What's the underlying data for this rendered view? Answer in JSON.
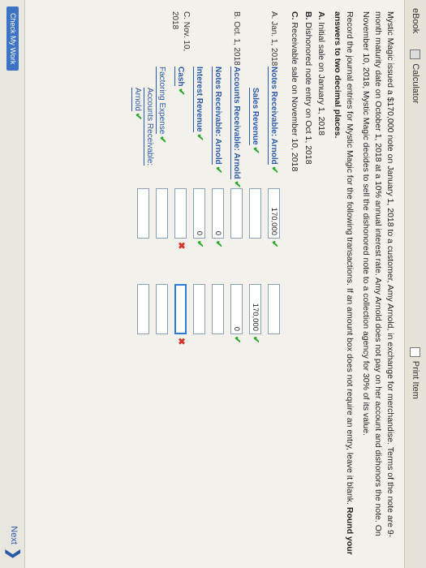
{
  "toolbar": {
    "ebook": "eBook",
    "calculator": "Calculator",
    "print": "Print Item"
  },
  "problem": {
    "paragraph": "Mystic Magic issued a $170,000 note on January 1, 2018 to a customer, Amy Arnold, in exchange for merchandise. Terms of the note are 9-month maturity date on October 1, 2018 at a 10% annual interest rate. Amy Arnold does not pay on her account and dishonors the note. On November 10, 2018, Mystic Magic decides to sell the dishonored note to a collection agency for 30% of its value.",
    "instruction": "Record the journal entries for Mystic Magic for the following transactions. If an amount box does not require an entry, leave it blank.",
    "instruction_bold": "Round your answers to two decimal places.",
    "transactions": [
      {
        "label": "A.",
        "text": "Initial sale on January 1, 2018"
      },
      {
        "label": "B.",
        "text": "Dishonored note entry on Oct 1, 2018"
      },
      {
        "label": "C.",
        "text": "Receivable sale on November 10, 2018"
      }
    ]
  },
  "journal": {
    "rows": [
      {
        "date": "A. Jan. 1, 2018",
        "account": "Notes Receivable: Arnold",
        "debit": "170,000",
        "credit": "",
        "debit_mark": "✔",
        "credit_mark": ""
      },
      {
        "date": "",
        "account": "Sales Revenue",
        "debit": "",
        "credit": "170,000",
        "debit_mark": "",
        "credit_mark": "✔"
      },
      {
        "date": "B. Oct. 1, 2018",
        "account": "Accounts Receivable: Arnold",
        "debit": "",
        "credit": "0",
        "debit_mark": "",
        "credit_mark": "✔"
      },
      {
        "date": "",
        "account": "Notes Receivable: Arnold",
        "debit": "0",
        "credit": "",
        "debit_mark": "✔",
        "credit_mark": ""
      },
      {
        "date": "",
        "account": "Interest Revenue",
        "debit": "0",
        "credit": "",
        "debit_mark": "✔",
        "credit_mark": ""
      },
      {
        "date": "C. Nov. 10, 2018",
        "account": "Cash",
        "debit": "",
        "credit": "",
        "debit_mark": "✖",
        "credit_mark": "✖"
      },
      {
        "date": "",
        "account": "Factoring Expense",
        "debit": "",
        "credit": "",
        "debit_mark": "",
        "credit_mark": ""
      },
      {
        "date": "",
        "account": "Accounts Receivable: Arnold",
        "debit": "",
        "credit": "",
        "debit_mark": "",
        "credit_mark": ""
      }
    ],
    "check": "✔"
  },
  "footer": {
    "check_work": "Check My Work",
    "next": "Next"
  }
}
